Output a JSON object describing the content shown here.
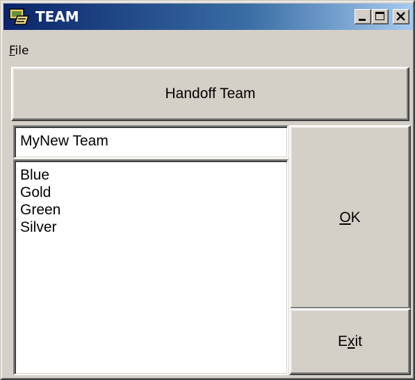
{
  "window": {
    "title": "TEAM",
    "app_icon": "team-app-icon",
    "controls": [
      "minimize-icon",
      "maximize-icon",
      "close-icon"
    ]
  },
  "menu": {
    "file": {
      "accel": "F",
      "rest": "ile"
    }
  },
  "buttons": {
    "handoff": "Handoff Team",
    "ok": {
      "accel": "O",
      "rest": "K"
    },
    "exit": {
      "pre": "E",
      "accel": "x",
      "post": "it"
    }
  },
  "team_name": {
    "value": "MyNew Team"
  },
  "team_list": {
    "items": [
      "Blue",
      "Gold",
      "Green",
      "Silver"
    ]
  },
  "colors": {
    "title_start": "#0a246a",
    "title_end": "#a6caf0",
    "face": "#d4d0c8"
  }
}
